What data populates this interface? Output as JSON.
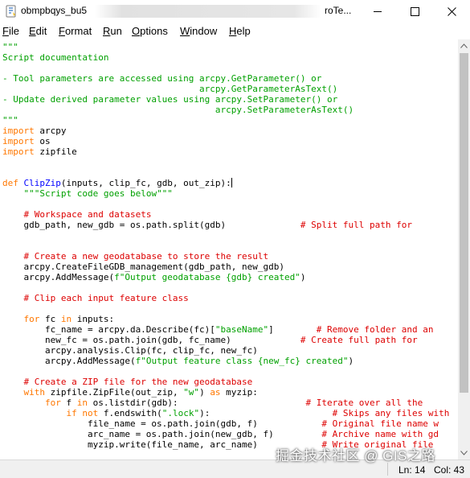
{
  "window": {
    "title": "obmpbqys_bu5",
    "title_tail": "roTe...",
    "icon": "python-feather-icon"
  },
  "menu": {
    "file": {
      "acc": "F",
      "rest": "ile"
    },
    "edit": {
      "acc": "E",
      "rest": "dit"
    },
    "format": {
      "acc": "F",
      "pre": "",
      "rest": "ormat"
    },
    "run": {
      "acc": "R",
      "rest": "un"
    },
    "options": {
      "acc": "O",
      "rest": "ptions"
    },
    "window": {
      "acc": "W",
      "rest": "indow"
    },
    "help": {
      "acc": "H",
      "rest": "elp"
    }
  },
  "editor": {
    "syntax_colors": {
      "string": "#00a000",
      "keyword": "#ff7700",
      "definition": "#0000ff",
      "comment": "#dd0000"
    },
    "lines": [
      [
        {
          "t": "\"\"\"",
          "c": "str"
        }
      ],
      [
        {
          "t": "Script documentation",
          "c": "str"
        }
      ],
      [
        {
          "t": "",
          "c": "str"
        }
      ],
      [
        {
          "t": "- Tool parameters are accessed using arcpy.GetParameter() or",
          "c": "str"
        }
      ],
      [
        {
          "t": "                                     arcpy.GetParameterAsText()",
          "c": "str"
        }
      ],
      [
        {
          "t": "- Update derived parameter values using arcpy.SetParameter() or",
          "c": "str"
        }
      ],
      [
        {
          "t": "                                        arcpy.SetParameterAsText()",
          "c": "str"
        }
      ],
      [
        {
          "t": "\"\"\"",
          "c": "str"
        }
      ],
      [
        {
          "t": "import",
          "c": "kw"
        },
        {
          "t": " arcpy",
          "c": ""
        }
      ],
      [
        {
          "t": "import",
          "c": "kw"
        },
        {
          "t": " os",
          "c": ""
        }
      ],
      [
        {
          "t": "import",
          "c": "kw"
        },
        {
          "t": " zipfile",
          "c": ""
        }
      ],
      [
        {
          "t": "",
          "c": ""
        }
      ],
      [
        {
          "t": "",
          "c": ""
        }
      ],
      [
        {
          "t": "def",
          "c": "kw"
        },
        {
          "t": " ",
          "c": ""
        },
        {
          "t": "ClipZip",
          "c": "def"
        },
        {
          "t": "(inputs, clip_fc, gdb, out_zip):",
          "c": ""
        },
        {
          "t": "",
          "c": "caret"
        }
      ],
      [
        {
          "t": "    ",
          "c": ""
        },
        {
          "t": "\"\"\"Script code goes below\"\"\"",
          "c": "str"
        }
      ],
      [
        {
          "t": "",
          "c": ""
        }
      ],
      [
        {
          "t": "    ",
          "c": ""
        },
        {
          "t": "# Workspace and datasets",
          "c": "cmt"
        }
      ],
      [
        {
          "t": "    gdb_path, new_gdb = os.path.split(gdb)              ",
          "c": ""
        },
        {
          "t": "# Split full path for",
          "c": "cmt"
        }
      ],
      [
        {
          "t": "",
          "c": ""
        }
      ],
      [
        {
          "t": "",
          "c": ""
        }
      ],
      [
        {
          "t": "    ",
          "c": ""
        },
        {
          "t": "# Create a new geodatabase to store the result",
          "c": "cmt"
        }
      ],
      [
        {
          "t": "    arcpy.CreateFileGDB_management(gdb_path, new_gdb)",
          "c": ""
        }
      ],
      [
        {
          "t": "    arcpy.AddMessage(",
          "c": ""
        },
        {
          "t": "f\"Output geodatabase {gdb} created\"",
          "c": "str"
        },
        {
          "t": ")",
          "c": ""
        }
      ],
      [
        {
          "t": "",
          "c": ""
        }
      ],
      [
        {
          "t": "    ",
          "c": ""
        },
        {
          "t": "# Clip each input feature class",
          "c": "cmt"
        }
      ],
      [
        {
          "t": "",
          "c": ""
        }
      ],
      [
        {
          "t": "    ",
          "c": ""
        },
        {
          "t": "for",
          "c": "kw"
        },
        {
          "t": " fc ",
          "c": ""
        },
        {
          "t": "in",
          "c": "kw"
        },
        {
          "t": " inputs:",
          "c": ""
        }
      ],
      [
        {
          "t": "        fc_name = arcpy.da.Describe(fc)[",
          "c": ""
        },
        {
          "t": "\"baseName\"",
          "c": "str"
        },
        {
          "t": "]        ",
          "c": ""
        },
        {
          "t": "# Remove folder and an",
          "c": "cmt"
        }
      ],
      [
        {
          "t": "        new_fc = os.path.join(gdb, fc_name)             ",
          "c": ""
        },
        {
          "t": "# Create full path for",
          "c": "cmt"
        }
      ],
      [
        {
          "t": "        arcpy.analysis.Clip(fc, clip_fc, new_fc)",
          "c": ""
        }
      ],
      [
        {
          "t": "        arcpy.AddMessage(",
          "c": ""
        },
        {
          "t": "f\"Output feature class {new_fc} created\"",
          "c": "str"
        },
        {
          "t": ")",
          "c": ""
        }
      ],
      [
        {
          "t": "",
          "c": ""
        }
      ],
      [
        {
          "t": "    ",
          "c": ""
        },
        {
          "t": "# Create a ZIP file for the new geodatabase",
          "c": "cmt"
        }
      ],
      [
        {
          "t": "    ",
          "c": ""
        },
        {
          "t": "with",
          "c": "kw"
        },
        {
          "t": " zipfile.ZipFile(out_zip, ",
          "c": ""
        },
        {
          "t": "\"w\"",
          "c": "str"
        },
        {
          "t": ") ",
          "c": ""
        },
        {
          "t": "as",
          "c": "kw"
        },
        {
          "t": " myzip:",
          "c": ""
        }
      ],
      [
        {
          "t": "        ",
          "c": ""
        },
        {
          "t": "for",
          "c": "kw"
        },
        {
          "t": " f ",
          "c": ""
        },
        {
          "t": "in",
          "c": "kw"
        },
        {
          "t": " os.listdir(gdb):                        ",
          "c": ""
        },
        {
          "t": "# Iterate over all the",
          "c": "cmt"
        }
      ],
      [
        {
          "t": "            ",
          "c": ""
        },
        {
          "t": "if not",
          "c": "kw"
        },
        {
          "t": " f.endswith(",
          "c": ""
        },
        {
          "t": "\".lock\"",
          "c": "str"
        },
        {
          "t": "):                       ",
          "c": ""
        },
        {
          "t": "# Skips any files with",
          "c": "cmt"
        }
      ],
      [
        {
          "t": "                file_name = os.path.join(gdb, f)            ",
          "c": ""
        },
        {
          "t": "# Original file name w",
          "c": "cmt"
        }
      ],
      [
        {
          "t": "                arc_name = os.path.join(new_gdb, f)         ",
          "c": ""
        },
        {
          "t": "# Archive name with gd",
          "c": "cmt"
        }
      ],
      [
        {
          "t": "                myzip.write(file_name, arc_name)            ",
          "c": ""
        },
        {
          "t": "# Write original file",
          "c": "cmt"
        }
      ]
    ]
  },
  "status": {
    "line": "Ln: 14",
    "col": "Col: 43"
  },
  "watermark": "掘金技术社区 @ GIS之路"
}
